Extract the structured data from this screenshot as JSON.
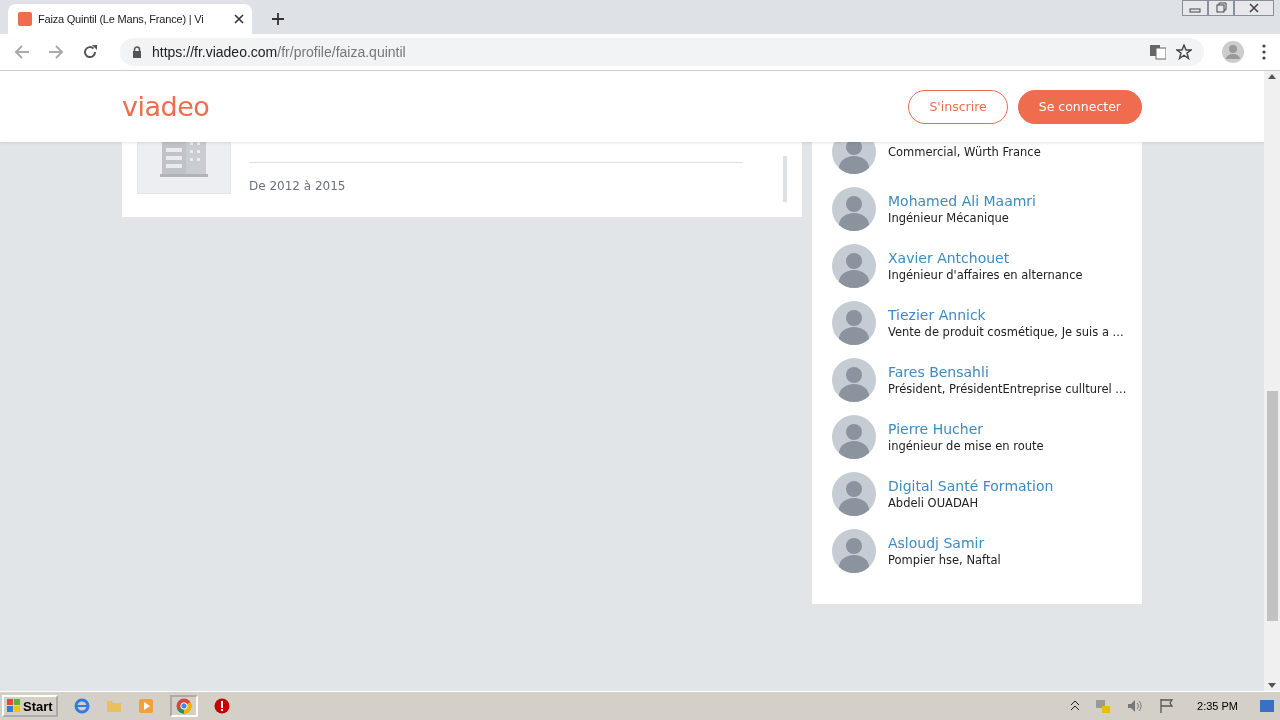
{
  "browser": {
    "tab_title": "Faiza Quintil (Le Mans, France) | Vi",
    "url_host": "https://fr.viadeo.com",
    "url_path": "/fr/profile/faiza.quintil"
  },
  "header": {
    "logo": "viadeo",
    "buttons": [
      {
        "label": "S'inscrire",
        "kind": "outline"
      },
      {
        "label": "Se connecter",
        "kind": "filled"
      }
    ]
  },
  "experience": {
    "dates": "De 2012 à 2015"
  },
  "people": [
    {
      "subtitle": "Commercial, Würth France"
    },
    {
      "name": "Mohamed Ali Maamri",
      "subtitle": "Ingénieur Mécanique"
    },
    {
      "name": "Xavier Antchouet",
      "subtitle": "Ingénieur d'affaires en alternance"
    },
    {
      "name": "Tiezier Annick",
      "subtitle": "Vente de produit cosmétique, Je suis a ..."
    },
    {
      "name": "Fares Bensahli",
      "subtitle": "Président, PrésidentEntreprise cullturel ..."
    },
    {
      "name": "Pierre Hucher",
      "subtitle": "ingénieur de mise en route"
    },
    {
      "name": "Digital Santé Formation",
      "subtitle": "Abdeli OUADAH"
    },
    {
      "name": "Asloudj Samir",
      "subtitle": "Pompier hse, Naftal"
    }
  ],
  "taskbar": {
    "start": "Start",
    "clock": "2:35 PM"
  }
}
